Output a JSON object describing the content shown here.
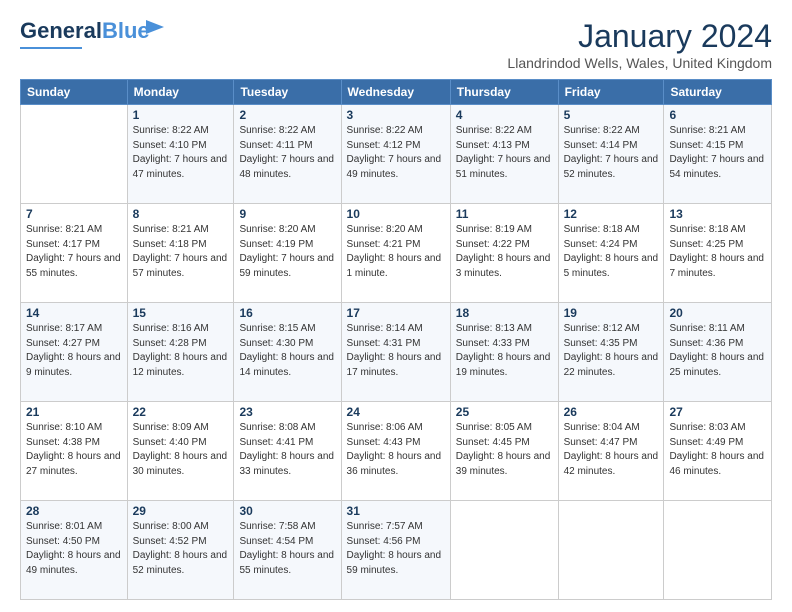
{
  "header": {
    "logo_general": "General",
    "logo_blue": "Blue",
    "month_title": "January 2024",
    "location": "Llandrindod Wells, Wales, United Kingdom"
  },
  "days_of_week": [
    "Sunday",
    "Monday",
    "Tuesday",
    "Wednesday",
    "Thursday",
    "Friday",
    "Saturday"
  ],
  "weeks": [
    [
      {
        "day": "",
        "sunrise": "",
        "sunset": "",
        "daylight": ""
      },
      {
        "day": "1",
        "sunrise": "Sunrise: 8:22 AM",
        "sunset": "Sunset: 4:10 PM",
        "daylight": "Daylight: 7 hours and 47 minutes."
      },
      {
        "day": "2",
        "sunrise": "Sunrise: 8:22 AM",
        "sunset": "Sunset: 4:11 PM",
        "daylight": "Daylight: 7 hours and 48 minutes."
      },
      {
        "day": "3",
        "sunrise": "Sunrise: 8:22 AM",
        "sunset": "Sunset: 4:12 PM",
        "daylight": "Daylight: 7 hours and 49 minutes."
      },
      {
        "day": "4",
        "sunrise": "Sunrise: 8:22 AM",
        "sunset": "Sunset: 4:13 PM",
        "daylight": "Daylight: 7 hours and 51 minutes."
      },
      {
        "day": "5",
        "sunrise": "Sunrise: 8:22 AM",
        "sunset": "Sunset: 4:14 PM",
        "daylight": "Daylight: 7 hours and 52 minutes."
      },
      {
        "day": "6",
        "sunrise": "Sunrise: 8:21 AM",
        "sunset": "Sunset: 4:15 PM",
        "daylight": "Daylight: 7 hours and 54 minutes."
      }
    ],
    [
      {
        "day": "7",
        "sunrise": "Sunrise: 8:21 AM",
        "sunset": "Sunset: 4:17 PM",
        "daylight": "Daylight: 7 hours and 55 minutes."
      },
      {
        "day": "8",
        "sunrise": "Sunrise: 8:21 AM",
        "sunset": "Sunset: 4:18 PM",
        "daylight": "Daylight: 7 hours and 57 minutes."
      },
      {
        "day": "9",
        "sunrise": "Sunrise: 8:20 AM",
        "sunset": "Sunset: 4:19 PM",
        "daylight": "Daylight: 7 hours and 59 minutes."
      },
      {
        "day": "10",
        "sunrise": "Sunrise: 8:20 AM",
        "sunset": "Sunset: 4:21 PM",
        "daylight": "Daylight: 8 hours and 1 minute."
      },
      {
        "day": "11",
        "sunrise": "Sunrise: 8:19 AM",
        "sunset": "Sunset: 4:22 PM",
        "daylight": "Daylight: 8 hours and 3 minutes."
      },
      {
        "day": "12",
        "sunrise": "Sunrise: 8:18 AM",
        "sunset": "Sunset: 4:24 PM",
        "daylight": "Daylight: 8 hours and 5 minutes."
      },
      {
        "day": "13",
        "sunrise": "Sunrise: 8:18 AM",
        "sunset": "Sunset: 4:25 PM",
        "daylight": "Daylight: 8 hours and 7 minutes."
      }
    ],
    [
      {
        "day": "14",
        "sunrise": "Sunrise: 8:17 AM",
        "sunset": "Sunset: 4:27 PM",
        "daylight": "Daylight: 8 hours and 9 minutes."
      },
      {
        "day": "15",
        "sunrise": "Sunrise: 8:16 AM",
        "sunset": "Sunset: 4:28 PM",
        "daylight": "Daylight: 8 hours and 12 minutes."
      },
      {
        "day": "16",
        "sunrise": "Sunrise: 8:15 AM",
        "sunset": "Sunset: 4:30 PM",
        "daylight": "Daylight: 8 hours and 14 minutes."
      },
      {
        "day": "17",
        "sunrise": "Sunrise: 8:14 AM",
        "sunset": "Sunset: 4:31 PM",
        "daylight": "Daylight: 8 hours and 17 minutes."
      },
      {
        "day": "18",
        "sunrise": "Sunrise: 8:13 AM",
        "sunset": "Sunset: 4:33 PM",
        "daylight": "Daylight: 8 hours and 19 minutes."
      },
      {
        "day": "19",
        "sunrise": "Sunrise: 8:12 AM",
        "sunset": "Sunset: 4:35 PM",
        "daylight": "Daylight: 8 hours and 22 minutes."
      },
      {
        "day": "20",
        "sunrise": "Sunrise: 8:11 AM",
        "sunset": "Sunset: 4:36 PM",
        "daylight": "Daylight: 8 hours and 25 minutes."
      }
    ],
    [
      {
        "day": "21",
        "sunrise": "Sunrise: 8:10 AM",
        "sunset": "Sunset: 4:38 PM",
        "daylight": "Daylight: 8 hours and 27 minutes."
      },
      {
        "day": "22",
        "sunrise": "Sunrise: 8:09 AM",
        "sunset": "Sunset: 4:40 PM",
        "daylight": "Daylight: 8 hours and 30 minutes."
      },
      {
        "day": "23",
        "sunrise": "Sunrise: 8:08 AM",
        "sunset": "Sunset: 4:41 PM",
        "daylight": "Daylight: 8 hours and 33 minutes."
      },
      {
        "day": "24",
        "sunrise": "Sunrise: 8:06 AM",
        "sunset": "Sunset: 4:43 PM",
        "daylight": "Daylight: 8 hours and 36 minutes."
      },
      {
        "day": "25",
        "sunrise": "Sunrise: 8:05 AM",
        "sunset": "Sunset: 4:45 PM",
        "daylight": "Daylight: 8 hours and 39 minutes."
      },
      {
        "day": "26",
        "sunrise": "Sunrise: 8:04 AM",
        "sunset": "Sunset: 4:47 PM",
        "daylight": "Daylight: 8 hours and 42 minutes."
      },
      {
        "day": "27",
        "sunrise": "Sunrise: 8:03 AM",
        "sunset": "Sunset: 4:49 PM",
        "daylight": "Daylight: 8 hours and 46 minutes."
      }
    ],
    [
      {
        "day": "28",
        "sunrise": "Sunrise: 8:01 AM",
        "sunset": "Sunset: 4:50 PM",
        "daylight": "Daylight: 8 hours and 49 minutes."
      },
      {
        "day": "29",
        "sunrise": "Sunrise: 8:00 AM",
        "sunset": "Sunset: 4:52 PM",
        "daylight": "Daylight: 8 hours and 52 minutes."
      },
      {
        "day": "30",
        "sunrise": "Sunrise: 7:58 AM",
        "sunset": "Sunset: 4:54 PM",
        "daylight": "Daylight: 8 hours and 55 minutes."
      },
      {
        "day": "31",
        "sunrise": "Sunrise: 7:57 AM",
        "sunset": "Sunset: 4:56 PM",
        "daylight": "Daylight: 8 hours and 59 minutes."
      },
      {
        "day": "",
        "sunrise": "",
        "sunset": "",
        "daylight": ""
      },
      {
        "day": "",
        "sunrise": "",
        "sunset": "",
        "daylight": ""
      },
      {
        "day": "",
        "sunrise": "",
        "sunset": "",
        "daylight": ""
      }
    ]
  ]
}
